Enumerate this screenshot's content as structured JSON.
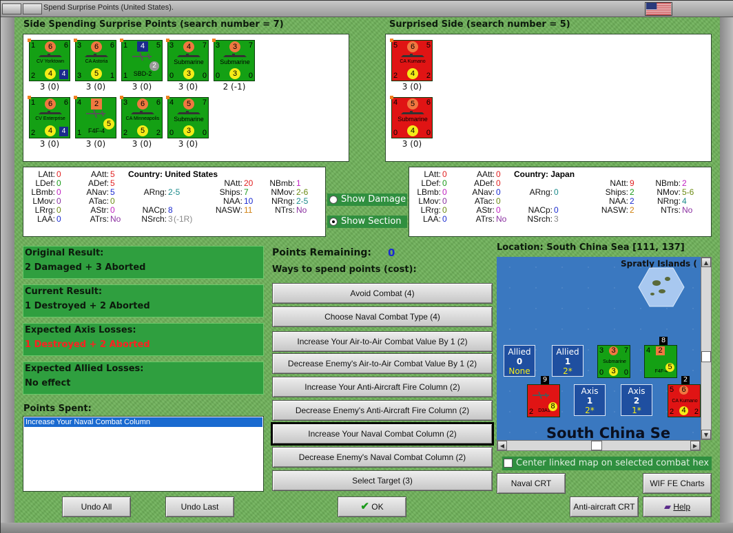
{
  "window": {
    "title": "Spend Surprise Points (United States)."
  },
  "spending_side": {
    "title": "Side Spending Surprise Points (search number = 7)",
    "counters": [
      {
        "tl": "1",
        "top": "6",
        "tr": "6",
        "name": "CV Yorktown",
        "bl": "2",
        "bot": "4",
        "br": "4",
        "label": "3 (0)"
      },
      {
        "tl": "3",
        "top": "6",
        "tr": "6",
        "name": "CA Astoria",
        "bl": "3",
        "bot": "5",
        "br": "1",
        "label": "3 (0)"
      },
      {
        "tl": "1",
        "top": "4",
        "tr": "5",
        "name": "SBD-2",
        "bl": "1",
        "bot": "",
        "br": "2",
        "label": "3 (0)"
      },
      {
        "tl": "3",
        "top": "4",
        "tr": "7",
        "name": "Submarine",
        "bl": "0",
        "bot": "3",
        "br": "0",
        "label": "3 (0)"
      },
      {
        "tl": "3",
        "top": "3",
        "tr": "7",
        "name": "Submarine",
        "bl": "0",
        "bot": "3",
        "br": "0",
        "label": "2 (-1)"
      },
      {
        "tl": "1",
        "top": "6",
        "tr": "6",
        "name": "CV Enterprise",
        "bl": "2",
        "bot": "4",
        "br": "4",
        "label": "3 (0)"
      },
      {
        "tl": "4",
        "top": "2",
        "tr": "",
        "name": "F4F-4",
        "bl": "1",
        "bot": "5",
        "br": "",
        "label": "3 (0)"
      },
      {
        "tl": "3",
        "top": "6",
        "tr": "6",
        "name": "CA Minneapolis",
        "bl": "2",
        "bot": "5",
        "br": "2",
        "label": "3 (0)"
      },
      {
        "tl": "4",
        "top": "5",
        "tr": "7",
        "name": "Submarine",
        "bl": "0",
        "bot": "3",
        "br": "0",
        "label": "3 (0)"
      }
    ]
  },
  "surprised_side": {
    "title": "Surprised Side (search number = 5)",
    "counters": [
      {
        "tl": "5",
        "top": "6",
        "tr": "5",
        "name": "CA Kumano",
        "bl": "2",
        "bot": "4",
        "br": "2",
        "label": "3 (0)"
      },
      {
        "tl": "4",
        "top": "5",
        "tr": "6",
        "name": "Submarine",
        "bl": "0",
        "bot": "4",
        "br": "0",
        "label": "3 (0)"
      }
    ]
  },
  "us_stats": {
    "country_label": "Country:",
    "country": "United States",
    "latt": "0",
    "ldef": "0",
    "lbmb": "0",
    "lmov": "0",
    "lrrg": "0",
    "laa": "0",
    "aatt": "5",
    "adef": "5",
    "anav": "5",
    "atac": "0",
    "astr": "0",
    "atrs": "No",
    "arng": "2-5",
    "nacp": "8",
    "nsrch": "3",
    "nsrch_note": "(-1R)",
    "natt": "20",
    "ships": "7",
    "naa": "10",
    "nasw": "11",
    "nbmb": "1",
    "nmov": "2-6",
    "nrng": "2-5",
    "ntrs": "No"
  },
  "jp_stats": {
    "country_label": "Country:",
    "country": "Japan",
    "latt": "0",
    "ldef": "0",
    "lbmb": "0",
    "lmov": "0",
    "lrrg": "0",
    "laa": "0",
    "aatt": "0",
    "adef": "0",
    "anav": "0",
    "atac": "0",
    "astr": "0",
    "atrs": "No",
    "arng": "0",
    "nacp": "0",
    "nsrch": "3",
    "natt": "9",
    "ships": "2",
    "naa": "2",
    "nasw": "2",
    "nbmb": "2",
    "nmov": "5-6",
    "nrng": "4",
    "ntrs": "No"
  },
  "stat_labels": {
    "latt": "LAtt:",
    "ldef": "LDef:",
    "lbmb": "LBmb:",
    "lmov": "LMov:",
    "lrrg": "LRrg:",
    "laa": "LAA:",
    "aatt": "AAtt:",
    "adef": "ADef:",
    "anav": "ANav:",
    "atac": "ATac:",
    "astr": "AStr:",
    "atrs": "ATrs:",
    "arng": "ARng:",
    "nacp": "NACp:",
    "nsrch": "NSrch:",
    "natt": "NAtt:",
    "ships": "Ships:",
    "naa": "NAA:",
    "nasw": "NASW:",
    "nbmb": "NBmb:",
    "nmov": "NMov:",
    "nrng": "NRng:",
    "ntrs": "NTrs:"
  },
  "options": {
    "show_damage": "Show Damage",
    "show_section": "Show Section"
  },
  "results": {
    "original_title": "Original Result:",
    "original_value": "2 Damaged + 3 Aborted",
    "current_title": "Current Result:",
    "current_value": "1 Destroyed + 2 Aborted",
    "axis_title": "Expected Axis Losses:",
    "axis_value": "1 Destroyed + 2 Aborted",
    "allied_title": "Expected Allied Losses:",
    "allied_value": "No effect"
  },
  "points_spent": {
    "title": "Points Spent:",
    "items": [
      "Increase Your Naval Combat Column"
    ]
  },
  "points_remaining": {
    "label": "Points Remaining:",
    "value": "0"
  },
  "ways_label": "Ways to spend points (cost):",
  "ways": [
    "Avoid Combat (4)",
    "Choose Naval Combat Type (4)",
    "Increase Your Air-to-Air Combat Value By 1 (2)",
    "Decrease Enemy's Air-to-Air Combat Value By 1 (2)",
    "Increase Your Anti-Aircraft Fire Column (2)",
    "Decrease Enemy's Anti-Aircraft Fire Column (2)",
    "Increase Your Naval Combat Column (2)",
    "Decrease Enemy's Naval Combat Column (2)",
    "Select Target (3)"
  ],
  "map": {
    "location": "Location: South China Sea [111, 137]",
    "spratly": "Spratly Islands (",
    "sea_name": "South China Se",
    "allied1": {
      "t": "Allied",
      "n": "0",
      "s": "None"
    },
    "allied2": {
      "t": "Allied",
      "n": "1",
      "s": "2*"
    },
    "axis1": {
      "t": "Axis",
      "n": "1",
      "s": "2*"
    },
    "axis2": {
      "t": "Axis",
      "n": "2",
      "s": "1*"
    },
    "stack_sub": {
      "tl": "3",
      "top": "3",
      "tr": "7",
      "name": "Submarine",
      "bl": "0",
      "bot": "3",
      "br": "0"
    },
    "stack_f4f": {
      "tl": "4",
      "top": "2",
      "name": "F4F-4",
      "bot": "5"
    },
    "stack_d3a": {
      "top": "",
      "name": "D3A1",
      "bl": "2",
      "bot": "8"
    },
    "stack_kumano": {
      "tl": "5",
      "top": "6",
      "name": "CA Kumano",
      "bl": "2",
      "bot": "4",
      "br": "2"
    },
    "stack_counts": [
      "8",
      "9",
      "2"
    ],
    "center_link": "Center linked map on selected combat hex"
  },
  "buttons": {
    "undo_all": "Undo All",
    "undo_last": "Undo Last",
    "ok": "OK",
    "naval_crt": "Naval CRT",
    "wif_charts": "WIF FE Charts",
    "aa_crt": "Anti-aircraft CRT",
    "help": "Help"
  }
}
